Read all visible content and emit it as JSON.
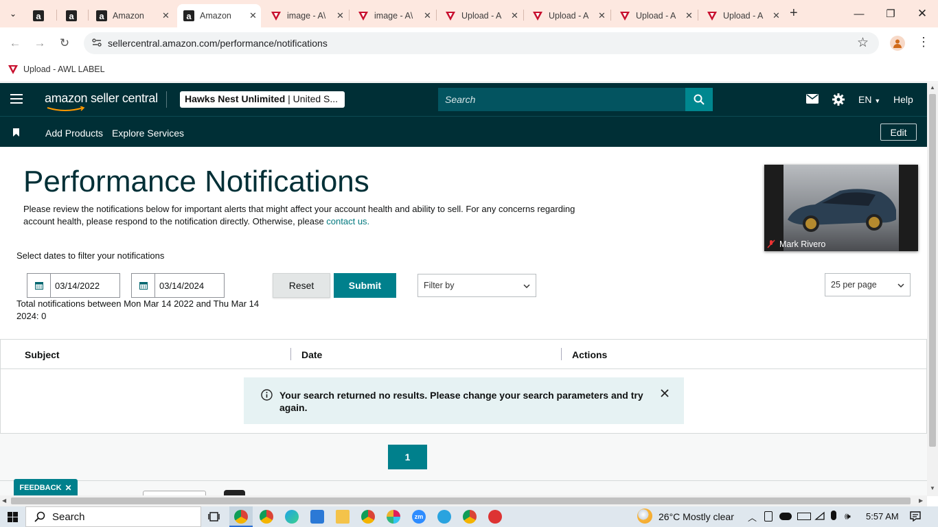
{
  "browser": {
    "tabs": [
      {
        "title": "",
        "icon": "amazon-a-icon"
      },
      {
        "title": "",
        "icon": "amazon-a-icon"
      },
      {
        "title": "Amazon",
        "icon": "amazon-a-icon"
      },
      {
        "title": "Amazon",
        "icon": "amazon-a-icon",
        "active": true
      },
      {
        "title": "image - A\\",
        "icon": "awl-triangle-icon"
      },
      {
        "title": "image - A\\",
        "icon": "awl-triangle-icon"
      },
      {
        "title": "Upload - A",
        "icon": "awl-triangle-icon"
      },
      {
        "title": "Upload - A",
        "icon": "awl-triangle-icon"
      },
      {
        "title": "Upload - A",
        "icon": "awl-triangle-icon"
      },
      {
        "title": "Upload - A",
        "icon": "awl-triangle-icon"
      }
    ],
    "url": "sellercentral.amazon.com/performance/notifications",
    "bookmark": "Upload - AWL LABEL"
  },
  "header": {
    "logo": "amazon seller central",
    "store_bold": "Hawks Nest Unlimited",
    "store_rest": " | United S...",
    "search_placeholder": "Search",
    "language": "EN",
    "help": "Help",
    "nav": [
      "Add Products",
      "Explore Services"
    ],
    "edit": "Edit"
  },
  "page": {
    "title": "Performance Notifications",
    "description": "Please review the notifications below for important alerts that might affect your account health and ability to sell. For any concerns regarding account health, please respond to the notification directly. Otherwise, please ",
    "contact_link": "contact us.",
    "filter_label": "Select dates to filter your notifications",
    "date_from": "03/14/2022",
    "date_to": "03/14/2024",
    "reset": "Reset",
    "submit": "Submit",
    "filter_by": "Filter by",
    "per_page": "25 per page",
    "total": "Total notifications between Mon Mar 14 2022 and Thu Mar 14 2024: 0",
    "columns": [
      "Subject",
      "Date",
      "Actions"
    ],
    "no_results": "Your search returned no results. Please change your search parameters and try again.",
    "page_number": "1",
    "feedback": "FEEDBACK"
  },
  "video": {
    "name": "Mark Rivero"
  },
  "taskbar": {
    "search": "Search",
    "weather": "26°C  Mostly clear",
    "time": "5:57 AM"
  },
  "colors": {
    "header": "#002f36",
    "accent": "#00808c",
    "tabstrip": "#fde8e0"
  }
}
